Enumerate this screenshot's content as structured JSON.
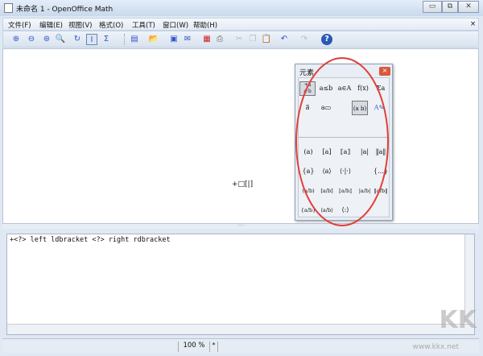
{
  "window": {
    "title": "未命名 1 - OpenOffice Math",
    "minimize": "▭",
    "restore": "⧉",
    "close": "✕"
  },
  "menu": [
    "文件(F)",
    "编辑(E)",
    "视图(V)",
    "格式(O)",
    "工具(T)",
    "窗口(W)",
    "帮助(H)"
  ],
  "menu_close": "×",
  "toolbar": [
    {
      "icon": "zoom-in-icon",
      "glyph": "⊕"
    },
    {
      "icon": "zoom-out-icon",
      "glyph": "⊖"
    },
    {
      "icon": "show-all-icon",
      "glyph": "⊛"
    },
    {
      "icon": "zoom-icon",
      "glyph": "🔍"
    },
    {
      "icon": "update-icon",
      "glyph": "↻"
    },
    {
      "icon": "formula-cursor-icon",
      "glyph": "I"
    },
    {
      "icon": "symbols-icon",
      "glyph": "Σ"
    },
    {
      "icon": "new-icon",
      "glyph": "▤"
    },
    {
      "icon": "open-icon",
      "glyph": "📂"
    },
    {
      "icon": "save-icon",
      "glyph": "▣"
    },
    {
      "icon": "email-icon",
      "glyph": "✉"
    },
    {
      "icon": "pdf-icon",
      "glyph": "▦"
    },
    {
      "icon": "print-icon",
      "glyph": "⎙"
    },
    {
      "icon": "cut-icon",
      "glyph": "✂"
    },
    {
      "icon": "copy-icon",
      "glyph": "❐"
    },
    {
      "icon": "paste-icon",
      "glyph": "📋"
    },
    {
      "icon": "undo-icon",
      "glyph": "↶"
    },
    {
      "icon": "redo-icon",
      "glyph": "↷"
    },
    {
      "icon": "help-icon",
      "glyph": "?"
    }
  ],
  "preview": {
    "formula": "+□[|]"
  },
  "editor": {
    "text": "+<?> left ldbracket <?> right rdbracket"
  },
  "status": {
    "zoom": "100 %",
    "modified": "*"
  },
  "elements_dialog": {
    "title": "元素",
    "close": "×",
    "categories": [
      "+a a·b",
      "a≤b",
      "a∈A",
      "f(x)",
      "Σa",
      "a⃗",
      "a▭",
      "(a b)",
      "A✎"
    ],
    "items": [
      [
        "(a)",
        "[a]",
        "⟦a⟧",
        "|a|",
        "‖a‖"
      ],
      [
        "{a}",
        "⟨a⟩",
        "⟨·|·⟩",
        "",
        "{…}"
      ],
      [
        "(a/b)",
        "[a/b]",
        "⟦a/b⟧",
        "|a/b|",
        "‖a/b‖"
      ],
      [
        "{a/b}",
        "⟨a/b⟩",
        "⟨:⟩",
        "",
        ""
      ]
    ]
  },
  "watermark": {
    "logo": "KK下载",
    "url": "www.kkx.net"
  },
  "annotation_color": "#e0403a"
}
